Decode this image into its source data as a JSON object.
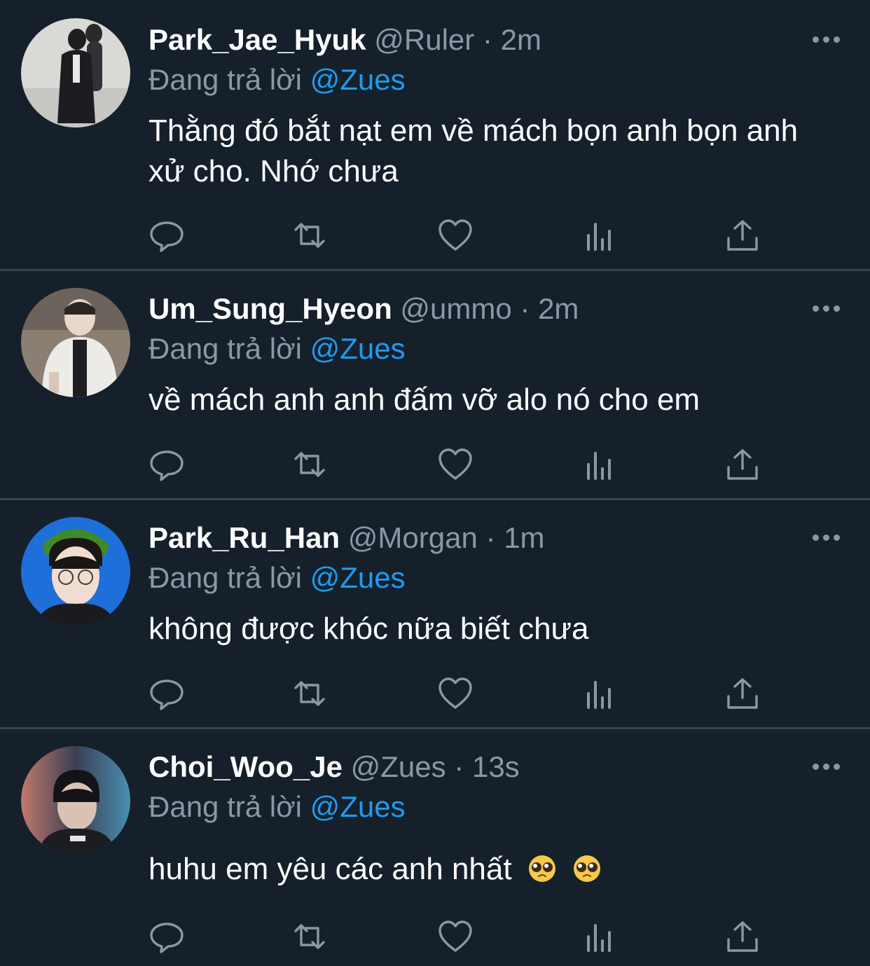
{
  "colors": {
    "background": "#15202b",
    "divider": "#38444d",
    "text_primary": "#ffffff",
    "text_secondary": "#8899a6",
    "link": "#1d9bf0"
  },
  "icons": {
    "more": "more-options-icon",
    "reply": "reply-icon",
    "retweet": "retweet-icon",
    "like": "heart-icon",
    "analytics": "analytics-icon",
    "share": "share-icon"
  },
  "tweets": [
    {
      "name": "Park_Jae_Hyuk",
      "handle": "@Ruler",
      "separator": "·",
      "time": "2m",
      "reply_prefix": "Đang trả lời",
      "reply_to": "@Zues",
      "text": "Thằng đó bắt nạt em về mách bọn anh bọn anh xử cho. Nhớ chưa"
    },
    {
      "name": "Um_Sung_Hyeon",
      "handle": "@ummo",
      "separator": "·",
      "time": "2m",
      "reply_prefix": "Đang trả lời",
      "reply_to": "@Zues",
      "text": "về mách anh anh đấm vỡ alo nó cho em"
    },
    {
      "name": "Park_Ru_Han",
      "handle": "@Morgan",
      "separator": "·",
      "time": "1m",
      "reply_prefix": "Đang trả lời",
      "reply_to": "@Zues",
      "text": "không được khóc nữa biết chưa"
    },
    {
      "name": "Choi_Woo_Je",
      "handle": "@Zues",
      "separator": "·",
      "time": "13s",
      "reply_prefix": "Đang trả lời",
      "reply_to": "@Zues",
      "text": "huhu em yêu các anh nhất",
      "emoji": [
        "pleading-face-emoji",
        "pleading-face-emoji"
      ]
    }
  ]
}
